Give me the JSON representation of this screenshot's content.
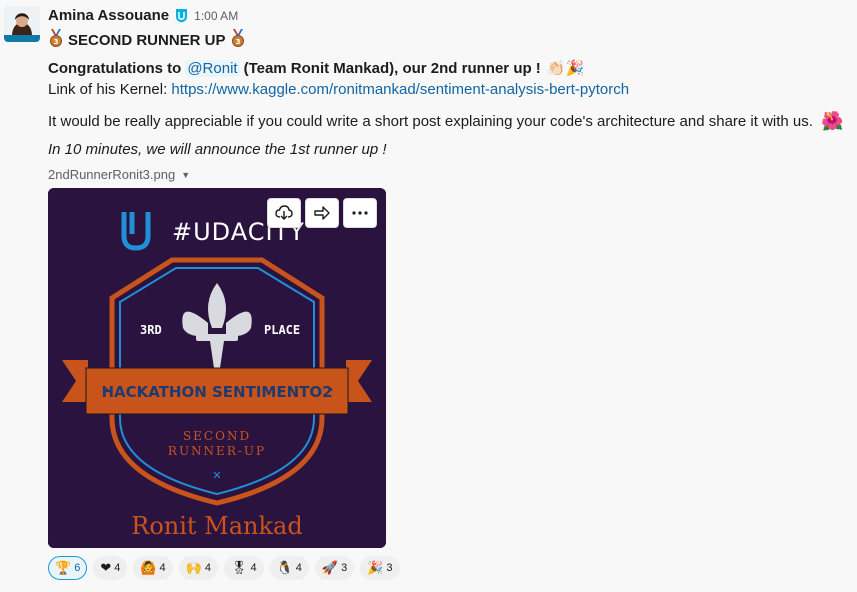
{
  "message": {
    "author": "Amina Assouane",
    "time": "1:00 AM",
    "title": "SECOND RUNNER UP",
    "congrats_prefix": "Congratulations to",
    "mention": "@Ronit",
    "congrats_suffix": "(Team Ronit Mankad), our 2nd runner up !",
    "kernel_prefix": "Link of his Kernel:",
    "kernel_link": "https://www.kaggle.com/ronitmankad/sentiment-analysis-bert-pytorch",
    "appreciate": "It would be really appreciable if you could write a short post explaining your code's architecture and share it with us.",
    "announce": "In 10 minutes, we will announce the 1st runner up !"
  },
  "attachment": {
    "filename": "2ndRunnerRonit3.png",
    "image": {
      "brand": "#UDACITY",
      "rank_left": "3RD",
      "rank_right": "PLACE",
      "banner": "HACKATHON SENTIMENTO2",
      "subtitle_1": "SECOND",
      "subtitle_2": "RUNNER-UP",
      "winner": "Ronit Mankad"
    }
  },
  "reactions": [
    {
      "icon": "trophy-icon",
      "glyph": "🏆",
      "count": "6",
      "active": true
    },
    {
      "icon": "heart-icon",
      "glyph": "❤",
      "count": "4"
    },
    {
      "icon": "person-raising-arms-icon",
      "glyph": "🙆",
      "count": "4"
    },
    {
      "icon": "raised-hands-icon",
      "glyph": "🙌",
      "count": "4"
    },
    {
      "icon": "medal-icon",
      "glyph": "🎖",
      "count": "4"
    },
    {
      "icon": "penguin-icon",
      "glyph": "🐧",
      "count": "4"
    },
    {
      "icon": "rocket-icon",
      "glyph": "🚀",
      "count": "3"
    },
    {
      "icon": "tada-icon",
      "glyph": "🎉",
      "count": "3"
    }
  ],
  "colors": {
    "link": "#1264a3",
    "badge_orange": "#c8541c",
    "badge_blue": "#1f8fd6",
    "image_bg": "#2b1340"
  }
}
